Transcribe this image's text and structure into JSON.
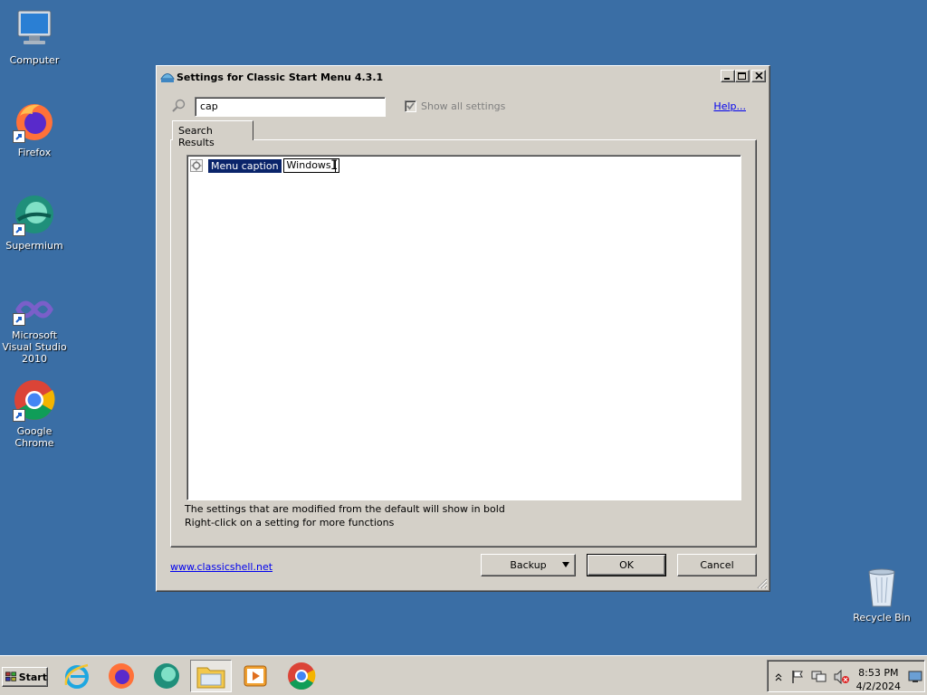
{
  "desktop": {
    "icons": [
      {
        "label": "Computer",
        "icon": "computer-icon"
      },
      {
        "label": "Firefox",
        "icon": "firefox-icon"
      },
      {
        "label": "Supermium",
        "icon": "supermium-icon"
      },
      {
        "label": "Microsoft Visual Studio 2010",
        "icon": "visual-studio-icon"
      },
      {
        "label": "Google Chrome",
        "icon": "chrome-icon"
      },
      {
        "label": "Recycle Bin",
        "icon": "recycle-bin-icon"
      }
    ]
  },
  "window": {
    "title": "Settings for Classic Start Menu 4.3.1",
    "search": {
      "value": "cap",
      "placeholder": ""
    },
    "show_all_settings": {
      "label": "Show all settings",
      "checked": true,
      "enabled": false
    },
    "help_label": "Help...",
    "tab_label": "Search Results",
    "setting": {
      "label": "Menu caption",
      "value": "Windows"
    },
    "info_line1": "The settings that are modified from the default will show in bold",
    "info_line2": "Right-click on a setting for more functions",
    "website_link": "www.classicshell.net",
    "buttons": {
      "backup": "Backup",
      "ok": "OK",
      "cancel": "Cancel"
    }
  },
  "taskbar": {
    "start_label": "Start",
    "apps": [
      "internet-explorer-icon",
      "firefox-icon",
      "supermium-icon",
      "explorer-folder-icon",
      "media-player-icon",
      "chrome-icon"
    ],
    "clock": {
      "time": "8:53 PM",
      "date": "4/2/2024"
    }
  },
  "colors": {
    "desktop": "#3a6ea5",
    "selection": "#0a246a",
    "face": "#d4d0c8",
    "link": "#0000ee"
  }
}
